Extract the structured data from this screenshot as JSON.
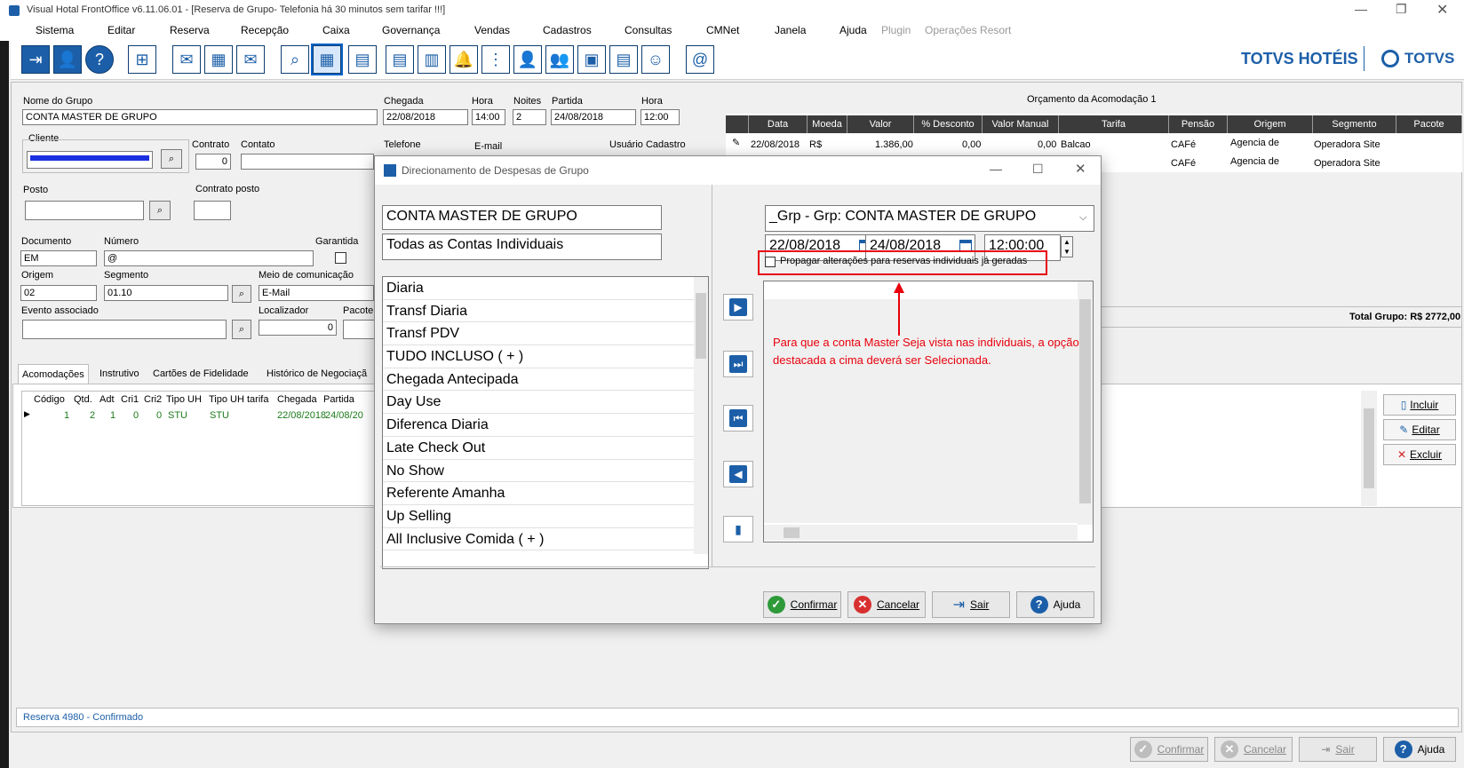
{
  "window": {
    "title": "Visual Hotal FrontOffice v6.11.06.01 - [Reserva de Grupo- Telefonia há 30 minutos sem tarifar !!!]"
  },
  "menu": [
    "Sistema",
    "Editar",
    "Reserva",
    "Recepção",
    "Caixa",
    "Governança",
    "Vendas",
    "Cadastros",
    "Consultas",
    "CMNet",
    "Janela",
    "Ajuda",
    "Plugin",
    "Operações Resort"
  ],
  "brand": {
    "hoteis": "TOTVS HOTÉIS",
    "totvs": "TOTVS"
  },
  "form": {
    "nome_grupo_label": "Nome do Grupo",
    "nome_grupo": "CONTA MASTER DE GRUPO",
    "chegada_label": "Chegada",
    "chegada": "22/08/2018",
    "hora_label": "Hora",
    "hora": "14:00",
    "noites_label": "Noites",
    "noites": "2",
    "partida_label": "Partida",
    "partida": "24/08/2018",
    "hora2_label": "Hora",
    "hora2": "12:00",
    "cliente_label": "Cliente",
    "contrato_label": "Contrato",
    "contrato": "0",
    "contato_label": "Contato",
    "telefone_label": "Telefone",
    "email_label": "E-mail",
    "usuario_label": "Usuário Cadastro",
    "posto_label": "Posto",
    "contrato_posto_label": "Contrato posto",
    "documento_label": "Documento",
    "documento": "EM",
    "numero_label": "Número",
    "numero": "@",
    "garantida_label": "Garantida",
    "origem_label": "Origem",
    "origem": "02",
    "segmento_label": "Segmento",
    "segmento": "01.10",
    "meio_label": "Meio de comunicação",
    "meio": "E-Mail",
    "evento_label": "Evento associado",
    "localizador_label": "Localizador",
    "localizador": "0",
    "pacote_label": "Pacote"
  },
  "orcamento": {
    "title": "Orçamento da Acomodação 1",
    "headers": [
      "Data",
      "Moeda",
      "Valor",
      "% Desconto",
      "Valor Manual",
      "Tarifa",
      "Pensão",
      "Origem",
      "Segmento",
      "Pacote"
    ],
    "rows": [
      {
        "data": "22/08/2018",
        "moeda": "R$",
        "valor": "1.386,00",
        "desconto": "0,00",
        "manual": "0,00",
        "tarifa": "Balcao",
        "pensao": "CAFé",
        "origem": "Agencia de",
        "segmento": "Operadora Site"
      },
      {
        "data": "",
        "moeda": "",
        "valor": "",
        "desconto": "",
        "manual": "",
        "tarifa": "",
        "pensao": "CAFé",
        "origem": "Agencia de",
        "segmento": "Operadora Site"
      }
    ],
    "total": "Total Grupo: R$ 2772,00"
  },
  "tabs": [
    "Acomodações",
    "Instrutivo",
    "Cartões de Fidelidade",
    "Histórico de Negociaçã"
  ],
  "acomod": {
    "headers": [
      "Código",
      "Qtd.",
      "Adt",
      "Cri1",
      "Cri2",
      "Tipo UH",
      "Tipo UH tarifa",
      "Chegada",
      "Partida"
    ],
    "row": [
      "1",
      "2",
      "1",
      "0",
      "0",
      "STU",
      "STU",
      "22/08/2018",
      "24/08/20"
    ]
  },
  "side_buttons": [
    "Incluir",
    "Editar",
    "Excluir"
  ],
  "status": "Reserva 4980 - Confirmado",
  "bottom_buttons": [
    "Confirmar",
    "Cancelar",
    "Sair",
    "Ajuda"
  ],
  "dialog": {
    "title": "Direcionamento de Despesas de Grupo",
    "group_name": "CONTA MASTER DE GRUPO",
    "accounts": "Todas as Contas Individuais",
    "list": [
      "Diaria",
      "Transf Diaria",
      "Transf PDV",
      "TUDO INCLUSO ( + )",
      "Chegada Antecipada",
      "Day Use",
      "Diferenca Diaria",
      "Late Check Out",
      "No Show",
      "Referente Amanha",
      "Up Selling",
      "All Inclusive Comida ( + )"
    ],
    "account_select": "_Grp - Grp: CONTA MASTER DE GRUPO",
    "date_from": "22/08/2018",
    "date_to": "24/08/2018",
    "time": "12:00:00",
    "propagar": "Propagar alterações para reservas individuais já geradas",
    "annotation": "Para que a conta Master Seja vista nas individuais, a opção destacada a cima deverá ser Selecionada.",
    "buttons": [
      "Confirmar",
      "Cancelar",
      "Sair",
      "Ajuda"
    ]
  },
  "colors": {
    "accent": "#1c5fa8",
    "annotation": "#e8000b",
    "grid_header": "#3b3b3b"
  }
}
